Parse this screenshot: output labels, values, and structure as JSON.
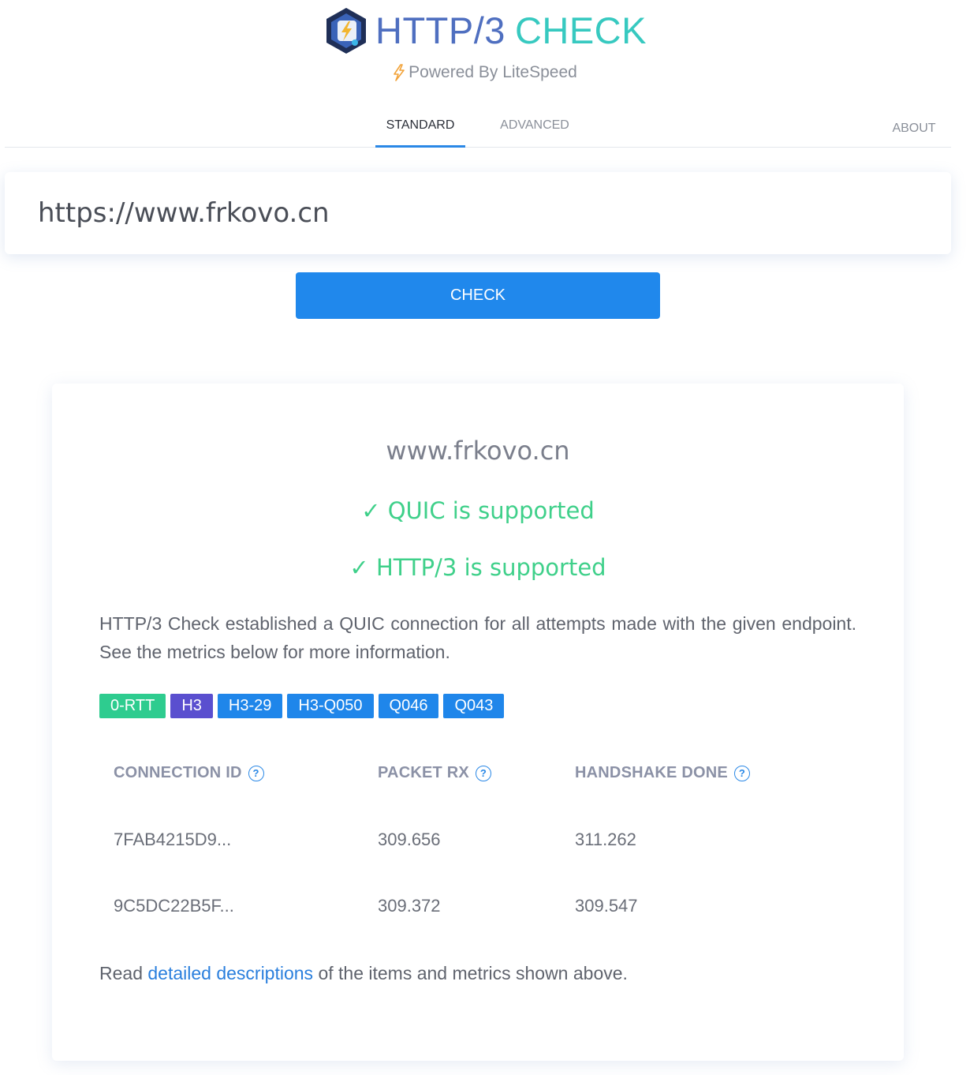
{
  "header": {
    "logo_part1": "HTTP/3",
    "logo_part2": "CHECK",
    "powered_by": "Powered By LiteSpeed"
  },
  "tabs": [
    {
      "label": "STANDARD",
      "active": true
    },
    {
      "label": "ADVANCED",
      "active": false
    },
    {
      "label": "ABOUT",
      "active": false
    }
  ],
  "search": {
    "value": "https://www.frkovo.cn",
    "button_label": "CHECK"
  },
  "result": {
    "domain": "www.frkovo.cn",
    "quic_status": "✓ QUIC is supported",
    "http3_status": "✓ HTTP/3 is supported",
    "description": "HTTP/3 Check established a QUIC connection for all attempts made with the given endpoint. See the metrics below for more information.",
    "badges": [
      {
        "label": "0-RTT",
        "color": "#2ecc8f"
      },
      {
        "label": "H3",
        "color": "#5a4fcf"
      },
      {
        "label": "H3-29",
        "color": "#1f86ea"
      },
      {
        "label": "H3-Q050",
        "color": "#1f86ea"
      },
      {
        "label": "Q046",
        "color": "#1f86ea"
      },
      {
        "label": "Q043",
        "color": "#1f86ea"
      }
    ],
    "metrics": {
      "headers": [
        "CONNECTION ID",
        "PACKET RX",
        "HANDSHAKE DONE"
      ],
      "help_glyph": "?",
      "rows": [
        [
          "7FAB4215D9...",
          "309.656",
          "311.262"
        ],
        [
          "9C5DC22B5F...",
          "309.372",
          "309.547"
        ]
      ]
    },
    "footer": {
      "prefix": "Read ",
      "link": "detailed descriptions",
      "suffix": " of the items and metrics shown above."
    }
  },
  "colors": {
    "accent": "#2088ec",
    "success": "#3fd08a",
    "logo_blue": "#4f6fc0",
    "logo_teal": "#37c9c0"
  }
}
